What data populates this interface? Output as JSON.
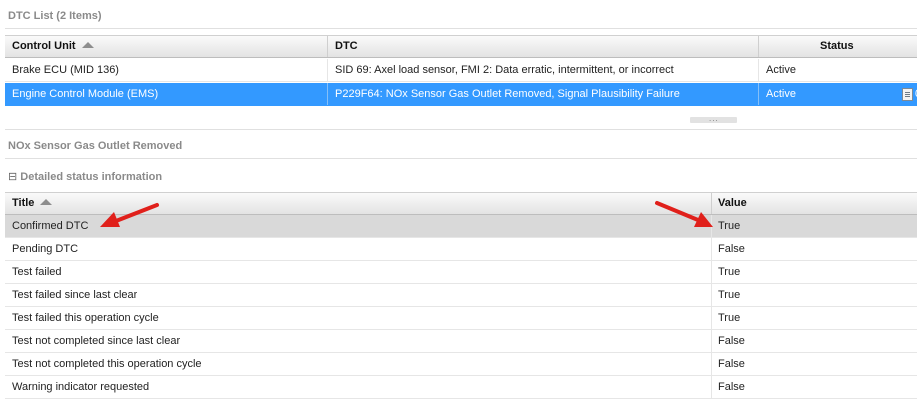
{
  "dtc_list": {
    "title": "DTC List (2 Items)",
    "columns": {
      "control_unit": "Control Unit",
      "dtc": "DTC",
      "status": "Status"
    },
    "rows": [
      {
        "control_unit": "Brake ECU (MID 136)",
        "dtc": "SID 69: Axel load sensor, FMI 2: Data erratic, intermittent, or incorrect",
        "status": "Active",
        "extra": ""
      },
      {
        "control_unit": "Engine Control Module (EMS)",
        "dtc": "P229F64: NOx Sensor Gas Outlet Removed, Signal Plausibility Failure",
        "status": "Active",
        "extra": "0"
      }
    ],
    "selected_row": 1
  },
  "splitter": {
    "grip": "..."
  },
  "detail": {
    "title": "NOx Sensor Gas Outlet Removed",
    "group_label": "Detailed status information",
    "collapse_glyph": "⊟",
    "columns": {
      "title": "Title",
      "value": "Value"
    },
    "rows": [
      {
        "title": "Confirmed DTC",
        "value": "True"
      },
      {
        "title": "Pending DTC",
        "value": "False"
      },
      {
        "title": "Test failed",
        "value": "True"
      },
      {
        "title": "Test failed since last clear",
        "value": "True"
      },
      {
        "title": "Test failed this operation cycle",
        "value": "True"
      },
      {
        "title": "Test not completed since last clear",
        "value": "False"
      },
      {
        "title": "Test not completed this operation cycle",
        "value": "False"
      },
      {
        "title": "Warning indicator requested",
        "value": "False"
      }
    ],
    "highlighted_row": 0
  },
  "colors": {
    "selection": "#3399ff",
    "highlight": "#d9d9d9",
    "arrow": "#e0201b"
  }
}
